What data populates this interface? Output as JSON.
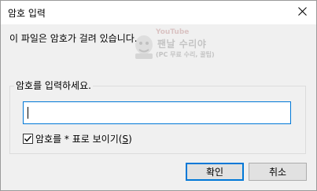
{
  "window": {
    "title": "암호 입력"
  },
  "message": "이 파일은 암호가 걸려 있습니다.",
  "watermark": {
    "platform": "YouTube",
    "channel": "팬날 수리야",
    "subtitle": "(PC 무료 수리, 꿀팁)"
  },
  "password_group": {
    "label": "암호를 입력하세요.",
    "input_value": ""
  },
  "show_password": {
    "label_prefix": "암호를 * 표로 보이기(",
    "accelerator": "S",
    "label_suffix": ")",
    "checked": true
  },
  "buttons": {
    "ok": "확인",
    "cancel": "취소"
  },
  "colors": {
    "focus": "#0078d7",
    "background": "#f0f0f0"
  }
}
